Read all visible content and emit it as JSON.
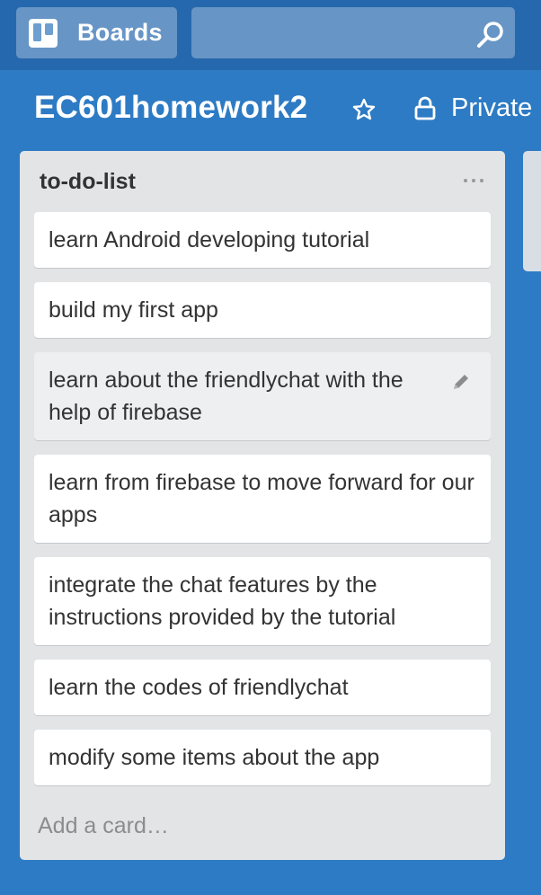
{
  "header": {
    "boards_label": "Boards",
    "search_placeholder": "",
    "icons": {
      "boards": "boards-icon",
      "search": "search-icon"
    }
  },
  "board": {
    "title": "EC601homework2",
    "visibility": "Private",
    "icons": {
      "star": "star-icon",
      "lock": "lock-icon"
    }
  },
  "list": {
    "title": "to-do-list",
    "menu_icon": "ellipsis-icon",
    "cards": [
      "learn Android developing tutorial",
      "build my first app",
      "learn about the friendlychat with the help of firebase",
      "learn from firebase to move forward for our apps",
      "integrate the chat features by the instructions provided by the tutorial",
      "learn the codes of friendlychat",
      "modify some items about the app"
    ],
    "add_card_label": "Add a card…"
  },
  "colors": {
    "background": "#2d7bc4",
    "header": "#2668ad",
    "list": "#e2e4e6",
    "card": "#ffffff"
  }
}
